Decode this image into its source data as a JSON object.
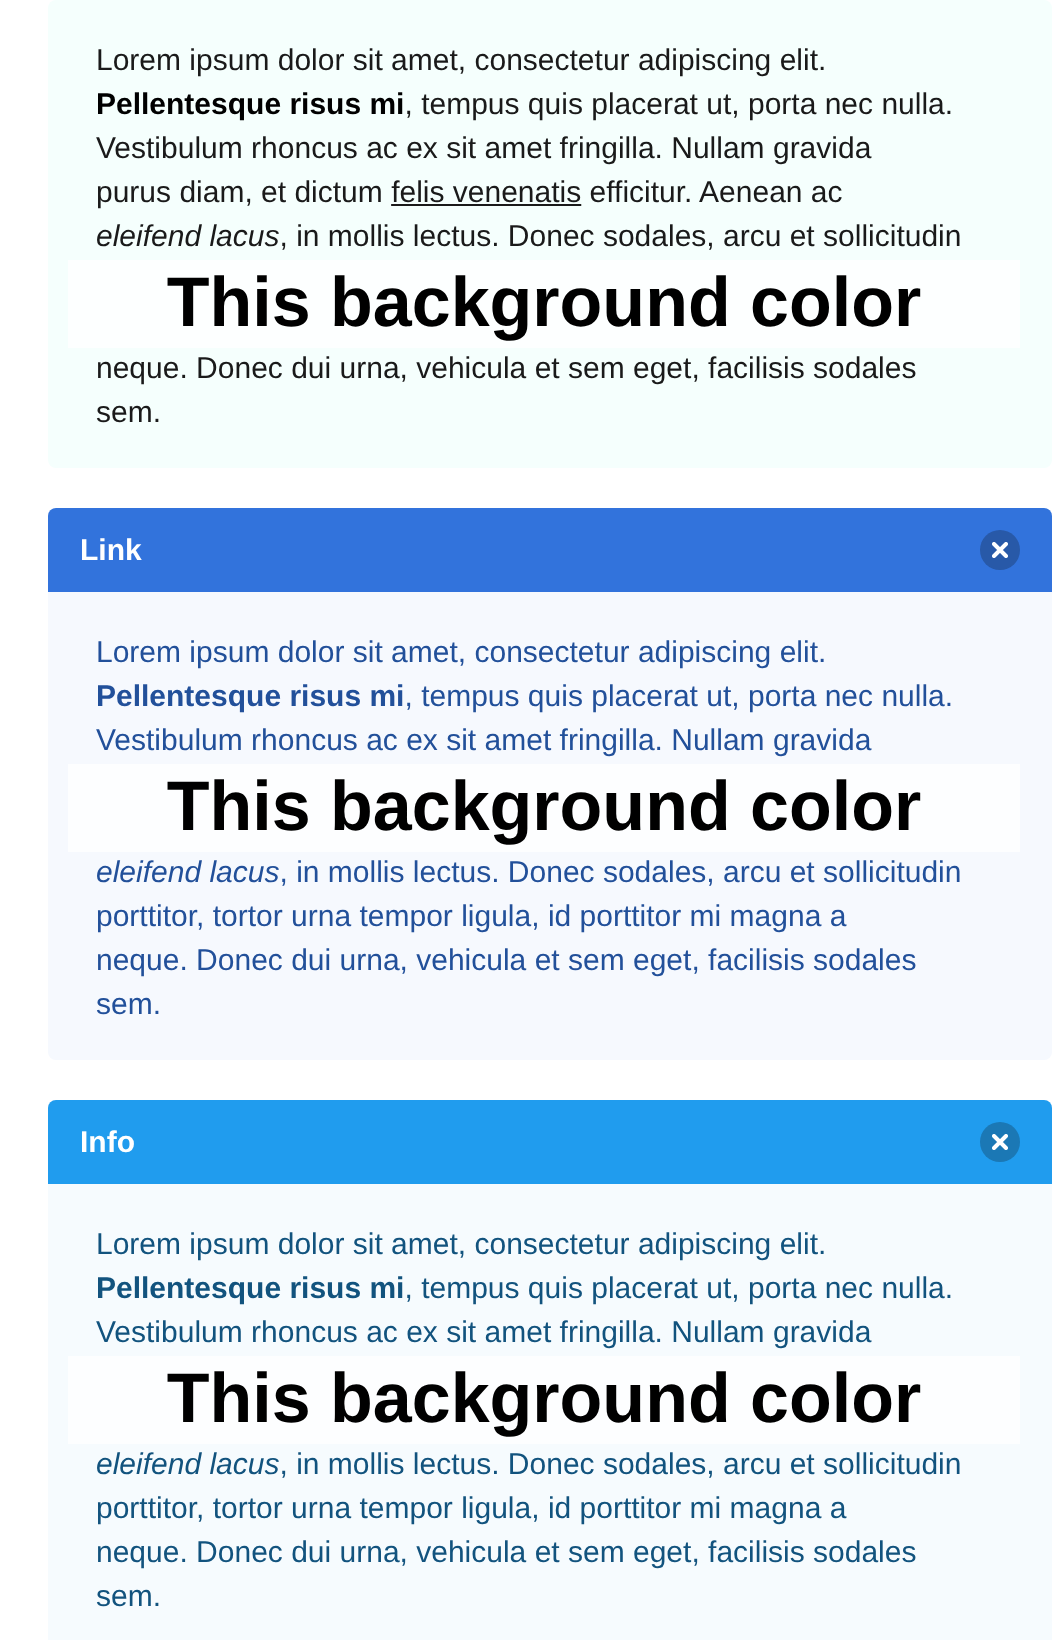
{
  "messages": [
    {
      "kind": "primary",
      "lines": [
        {
          "kind": "text",
          "text": "Lorem ipsum dolor sit amet, consectetur adipiscing elit."
        },
        {
          "kind": "text",
          "text": "**Pellentesque risus mi**, tempus quis placerat ut, porta nec nulla."
        },
        {
          "kind": "text",
          "text": "Vestibulum rhoncus ac ex sit amet fringilla. Nullam gravida"
        },
        {
          "kind": "text",
          "text": "purus diam, et dictum ",
          "link": "felis venenatis",
          "after": " efficitur. Aenean ac"
        },
        {
          "kind": "text",
          "text": "*eleifend lacus*, in mollis lectus. Donec sodales, arcu et sollicitudin"
        },
        {
          "kind": "annotation",
          "text": "This background color"
        },
        {
          "kind": "text",
          "text": "neque. Donec dui urna, vehicula et sem eget, facilisis sodales"
        },
        {
          "kind": "text",
          "text": "sem."
        }
      ]
    },
    {
      "kind": "link",
      "header": "Link",
      "lines": [
        {
          "kind": "text",
          "text": "Lorem ipsum dolor sit amet, consectetur adipiscing elit."
        },
        {
          "kind": "text",
          "text": "**Pellentesque risus mi**, tempus quis placerat ut, porta nec nulla."
        },
        {
          "kind": "text",
          "text": "Vestibulum rhoncus ac ex sit amet fringilla. Nullam gravida"
        },
        {
          "kind": "annotation",
          "text": "This background color"
        },
        {
          "kind": "text",
          "text": "*eleifend lacus*, in mollis lectus. Donec sodales, arcu et sollicitudin"
        },
        {
          "kind": "text",
          "text": "porttitor, tortor urna tempor ligula, id porttitor mi magna a"
        },
        {
          "kind": "text",
          "text": "neque. Donec dui urna, vehicula et sem eget, facilisis sodales"
        },
        {
          "kind": "text",
          "text": "sem."
        }
      ]
    },
    {
      "kind": "info",
      "header": "Info",
      "lines": [
        {
          "kind": "text",
          "text": "Lorem ipsum dolor sit amet, consectetur adipiscing elit."
        },
        {
          "kind": "text",
          "text": "**Pellentesque risus mi**, tempus quis placerat ut, porta nec nulla."
        },
        {
          "kind": "text",
          "text": "Vestibulum rhoncus ac ex sit amet fringilla. Nullam gravida"
        },
        {
          "kind": "annotation",
          "text": "This background color"
        },
        {
          "kind": "text",
          "text": "*eleifend lacus*, in mollis lectus. Donec sodales, arcu et sollicitudin"
        },
        {
          "kind": "text",
          "text": "porttitor, tortor urna tempor ligula, id porttitor mi magna a"
        },
        {
          "kind": "text",
          "text": "neque. Donec dui urna, vehicula et sem eget, facilisis sodales"
        },
        {
          "kind": "text",
          "text": "sem."
        }
      ]
    }
  ]
}
